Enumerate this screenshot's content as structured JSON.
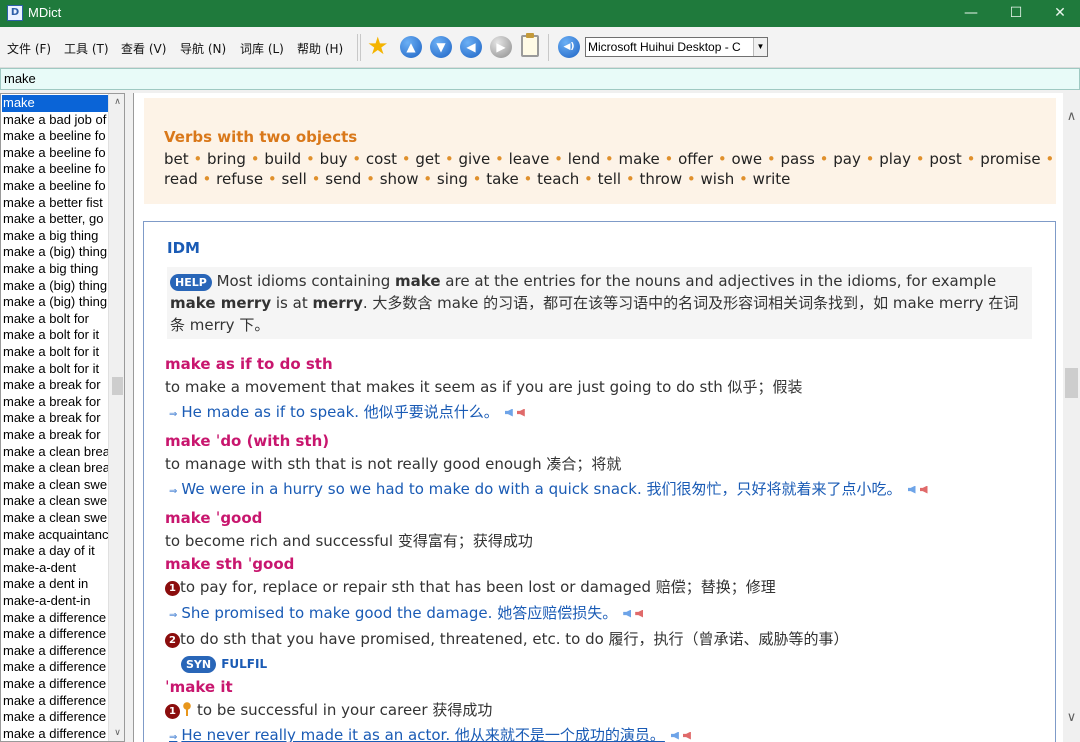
{
  "window": {
    "title": "MDict",
    "controls": {
      "minimize": "—",
      "maximize": "☐",
      "close": "✕"
    }
  },
  "menu": [
    "文件 (F)",
    "工具 (T)",
    "查看 (V)",
    "导航 (N)",
    "词库 (L)",
    "帮助 (H)"
  ],
  "toolbar": {
    "dictionary": "Microsoft Huihui Desktop - C",
    "dropdown_arrow": "▼"
  },
  "search": {
    "value": "make"
  },
  "wordlist": [
    "make",
    "make a bad job of",
    "make a beeline fo",
    "make a beeline fo",
    "make a beeline fo",
    "make a beeline fo",
    "make a better fist",
    "make a better, go",
    "make a big thing",
    "make a (big) thing",
    "make a big thing",
    "make a (big) thing",
    "make a (big) thing",
    "make a bolt for",
    "make a bolt for it",
    "make a bolt for it",
    "make a bolt for it",
    "make a break for",
    "make a break for",
    "make a break for",
    "make a break for",
    "make a clean brea",
    "make a clean brea",
    "make a clean swe",
    "make a clean swe",
    "make a clean swe",
    "make acquaintanc",
    "make a day of it",
    "make-a-dent",
    "make a dent in",
    "make-a-dent-in",
    "make a difference",
    "make a difference",
    "make a difference",
    "make a difference",
    "make a difference",
    "make a difference",
    "make a difference",
    "make a difference"
  ],
  "box1": {
    "heading": "Verbs with two objects",
    "line1": [
      "bet",
      "bring",
      "build",
      "buy",
      "cost",
      "get",
      "give",
      "leave",
      "lend",
      "make",
      "offer",
      "owe",
      "pass",
      "pay",
      "play",
      "post",
      "promise"
    ],
    "line2": [
      "read",
      "refuse",
      "sell",
      "send",
      "show",
      "sing",
      "take",
      "teach",
      "tell",
      "throw",
      "wish",
      "write"
    ]
  },
  "idm": {
    "heading": "IDM",
    "help_badge": "HELP",
    "help": {
      "t1": " Most idioms containing ",
      "b1": "make",
      "t2": " are at the entries for the nouns and adjectives in the idioms, for example",
      "b2": "make merry",
      "t3": " is at ",
      "b3": "merry",
      "t4": ". 大多数含 make 的习语，都可在该等习语中的名词及形容词相关词条找到，如 make merry 在词",
      "t5": "条 merry 下。"
    },
    "entries": {
      "e1": {
        "hw": "make as if to do sth",
        "def": "to make a movement that makes it seem as if you are just going to do sth 似乎；假装",
        "ex": "He made as if to speak. 他似乎要说点什么。"
      },
      "e2": {
        "hw": "make ˈdo (with sth)",
        "def": "to manage with sth that is not really good enough 凑合；将就",
        "ex": "We were in a hurry so we had to make do with a quick snack. 我们很匆忙，只好将就着来了点小吃。"
      },
      "e3": {
        "hw": "make ˈgood",
        "def": "to become rich and successful 变得富有；获得成功"
      },
      "e4": {
        "hw": "make sth ˈgood",
        "n1": "1",
        "d1": "to pay for, replace or repair sth that has been lost or damaged 赔偿；替换；修理",
        "ex1": "She promised to make good the damage. 她答应赔偿损失。",
        "n2": "2",
        "d2": "to do sth that you have promised, threatened, etc. to do 履行，执行（曾承诺、威胁等的事）",
        "syn_badge": "SYN",
        "syn": "FULFIL"
      },
      "e5": {
        "hw": "ˈmake it",
        "n1": "1",
        "d1": "to be successful in your career 获得成功",
        "ex1": "He never really made it as an actor. 他从来就不是一个成功的演员。"
      }
    }
  },
  "icons": {
    "arrow": "⇒",
    "up": "▲",
    "down": "▼",
    "left": "◀",
    "right": "▶"
  }
}
